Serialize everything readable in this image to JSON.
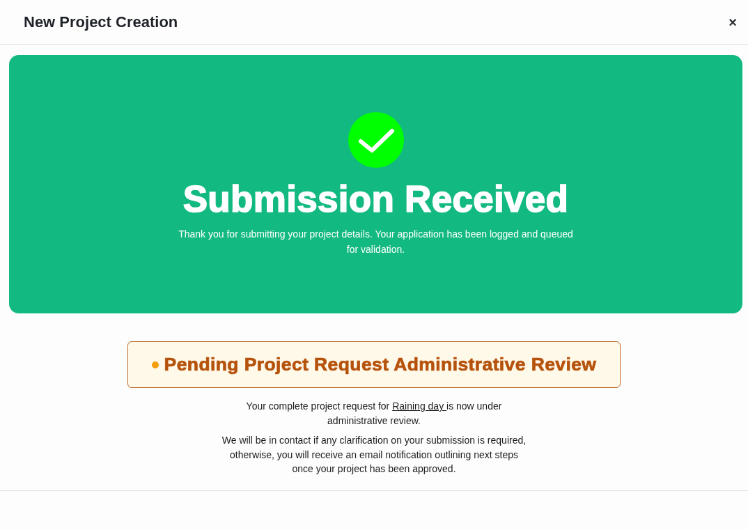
{
  "dialog": {
    "title": "New Project Creation",
    "close_label": "×"
  },
  "banner": {
    "title": "Submission Received",
    "message": "Thank you for submitting your project details. Your application has been logged and queued for validation."
  },
  "status": {
    "kind": "pending",
    "label": "Pending Project Request Administrative Review"
  },
  "paragraphs": [
    {
      "text_before": "Your complete project request for ",
      "link": "Raining day ",
      "text_after": "is now under administrative review."
    },
    {
      "text": "We will be in contact if any clarification on your submission is required, otherwise, you will receive an email notification outlining next steps once your project has been approved."
    }
  ]
}
